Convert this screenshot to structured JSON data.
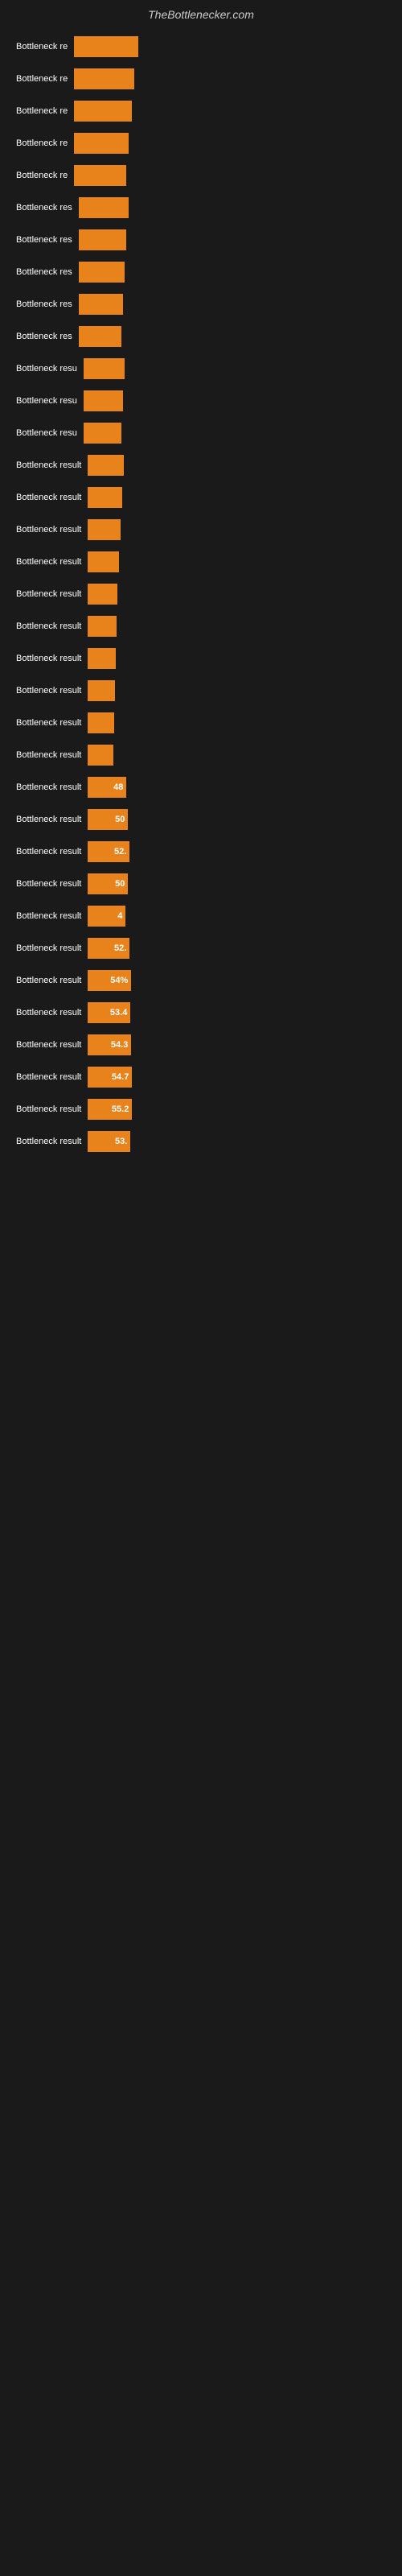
{
  "header": {
    "title": "TheBottlenecker.com"
  },
  "bars": [
    {
      "label": "Bottleneck re",
      "width": 80,
      "value": ""
    },
    {
      "label": "Bottleneck re",
      "width": 75,
      "value": ""
    },
    {
      "label": "Bottleneck re",
      "width": 72,
      "value": ""
    },
    {
      "label": "Bottleneck re",
      "width": 68,
      "value": ""
    },
    {
      "label": "Bottleneck re",
      "width": 65,
      "value": ""
    },
    {
      "label": "Bottleneck res",
      "width": 62,
      "value": ""
    },
    {
      "label": "Bottleneck res",
      "width": 59,
      "value": ""
    },
    {
      "label": "Bottleneck res",
      "width": 57,
      "value": ""
    },
    {
      "label": "Bottleneck res",
      "width": 55,
      "value": ""
    },
    {
      "label": "Bottleneck res",
      "width": 53,
      "value": ""
    },
    {
      "label": "Bottleneck resu",
      "width": 51,
      "value": ""
    },
    {
      "label": "Bottleneck resu",
      "width": 49,
      "value": ""
    },
    {
      "label": "Bottleneck resu",
      "width": 47,
      "value": ""
    },
    {
      "label": "Bottleneck result",
      "width": 45,
      "value": ""
    },
    {
      "label": "Bottleneck result",
      "width": 43,
      "value": ""
    },
    {
      "label": "Bottleneck result",
      "width": 41,
      "value": ""
    },
    {
      "label": "Bottleneck result",
      "width": 39,
      "value": ""
    },
    {
      "label": "Bottleneck result",
      "width": 37,
      "value": ""
    },
    {
      "label": "Bottleneck result",
      "width": 36,
      "value": ""
    },
    {
      "label": "Bottleneck result",
      "width": 35,
      "value": ""
    },
    {
      "label": "Bottleneck result",
      "width": 34,
      "value": ""
    },
    {
      "label": "Bottleneck result",
      "width": 33,
      "value": ""
    },
    {
      "label": "Bottleneck result",
      "width": 32,
      "value": ""
    },
    {
      "label": "Bottleneck result",
      "width": 48,
      "value": "48"
    },
    {
      "label": "Bottleneck result",
      "width": 50,
      "value": "50"
    },
    {
      "label": "Bottleneck result",
      "width": 52,
      "value": "52."
    },
    {
      "label": "Bottleneck result",
      "width": 50,
      "value": "50"
    },
    {
      "label": "Bottleneck result",
      "width": 47,
      "value": "4"
    },
    {
      "label": "Bottleneck result",
      "width": 52,
      "value": "52."
    },
    {
      "label": "Bottleneck result",
      "width": 54,
      "value": "54%"
    },
    {
      "label": "Bottleneck result",
      "width": 53,
      "value": "53.4"
    },
    {
      "label": "Bottleneck result",
      "width": 54,
      "value": "54.3"
    },
    {
      "label": "Bottleneck result",
      "width": 55,
      "value": "54.7"
    },
    {
      "label": "Bottleneck result",
      "width": 55,
      "value": "55.2"
    },
    {
      "label": "Bottleneck result",
      "width": 53,
      "value": "53."
    }
  ]
}
